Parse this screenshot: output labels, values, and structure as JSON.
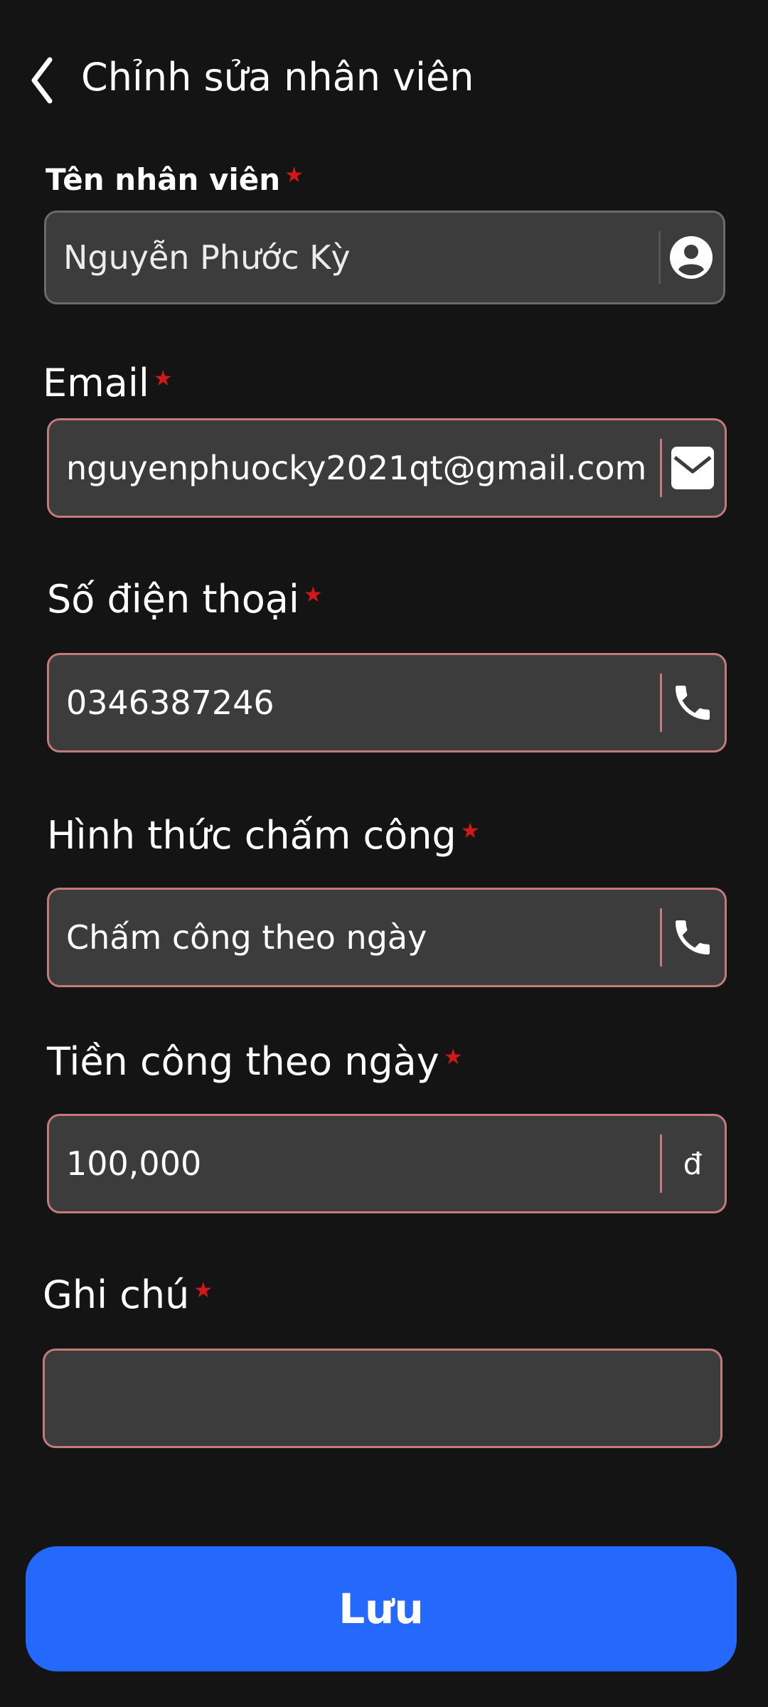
{
  "header": {
    "title": "Chỉnh sửa nhân viên"
  },
  "required_mark": "★",
  "fields": {
    "name": {
      "label": "Tên nhân viên",
      "value": "Nguyễn Phước Kỳ",
      "icon": "user-circle-icon"
    },
    "email": {
      "label": "Email",
      "value": "nguyenphuocky2021qt@gmail.com",
      "icon": "mail-icon"
    },
    "phone": {
      "label": "Số điện thoại",
      "value": "0346387246",
      "icon": "phone-icon"
    },
    "attendance": {
      "label": "Hình thức chấm công",
      "value": "Chấm công theo ngày",
      "icon": "phone-icon"
    },
    "wage": {
      "label": "Tiền công theo ngày",
      "value": "100,000",
      "suffix": "đ"
    },
    "note": {
      "label": "Ghi chú",
      "value": ""
    }
  },
  "save_button": {
    "label": "Lưu"
  },
  "colors": {
    "background": "#141414",
    "field_bg": "#3c3c3c",
    "field_border": "#c37a78",
    "primary": "#2469fb",
    "required": "#d01818"
  }
}
